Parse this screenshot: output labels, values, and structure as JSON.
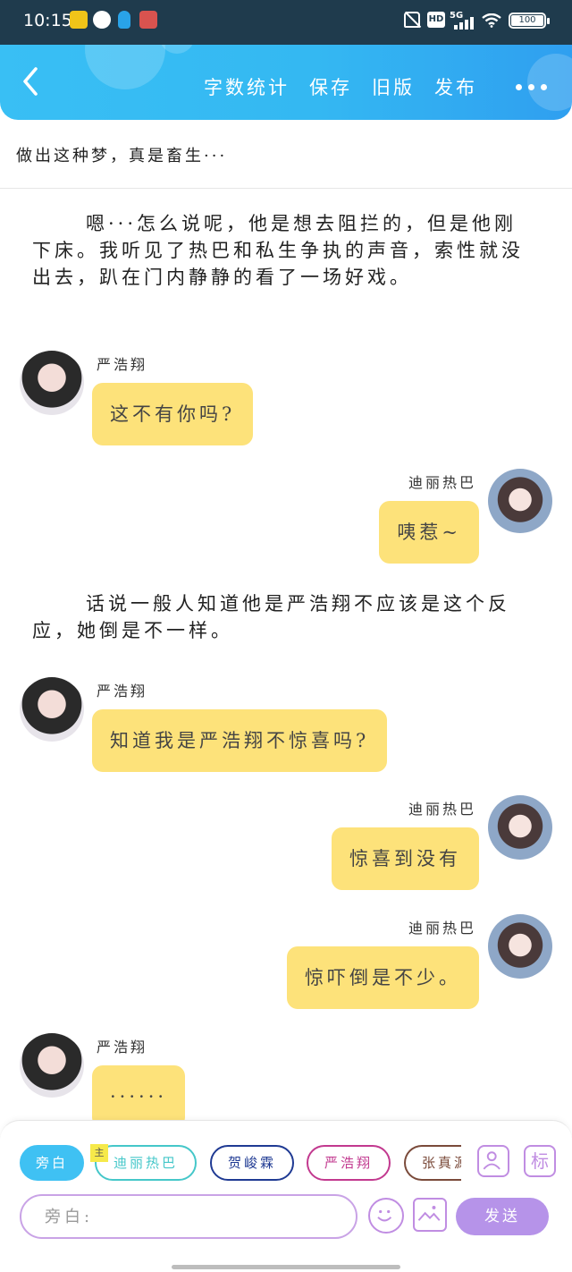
{
  "status_bar": {
    "time": "10:15",
    "network": "5G",
    "hd_label": "HD",
    "battery": "100"
  },
  "header": {
    "actions": [
      "字数统计",
      "保存",
      "旧版",
      "发布"
    ],
    "accent_color": "#39bff4"
  },
  "chapter_title": "做出这种梦，真是畜生···",
  "narrations": [
    "嗯···怎么说呢，他是想去阻拦的，但是他刚下床。我听见了热巴和私生争执的声音，索性就没出去，趴在门内静静的看了一场好戏。",
    "话说一般人知道他是严浩翔不应该是这个反应，她倒是不一样。"
  ],
  "messages": [
    {
      "name": "严浩翔",
      "text": "这不有你吗?",
      "side": "left"
    },
    {
      "name": "迪丽热巴",
      "text": "咦惹~",
      "side": "right"
    },
    {
      "name": "严浩翔",
      "text": "知道我是严浩翔不惊喜吗?",
      "side": "left"
    },
    {
      "name": "迪丽热巴",
      "text": "惊喜到没有",
      "side": "right"
    },
    {
      "name": "迪丽热巴",
      "text": "惊吓倒是不少。",
      "side": "right"
    },
    {
      "name": "严浩翔",
      "text": "······",
      "side": "left"
    }
  ],
  "composer": {
    "roles": [
      {
        "label": "旁白",
        "color": "#3fc1f3"
      },
      {
        "label": "迪丽热巴",
        "color": "#45c7c9"
      },
      {
        "label": "贺峻霖",
        "color": "#1f3a93"
      },
      {
        "label": "严浩翔",
        "color": "#c2398f"
      },
      {
        "label": "张真源",
        "color": "#7a4a3a"
      }
    ],
    "main_tag": "主",
    "biao_label": "标",
    "placeholder": "旁白:",
    "send_label": "发送",
    "accent_purple": "#b693e9"
  }
}
